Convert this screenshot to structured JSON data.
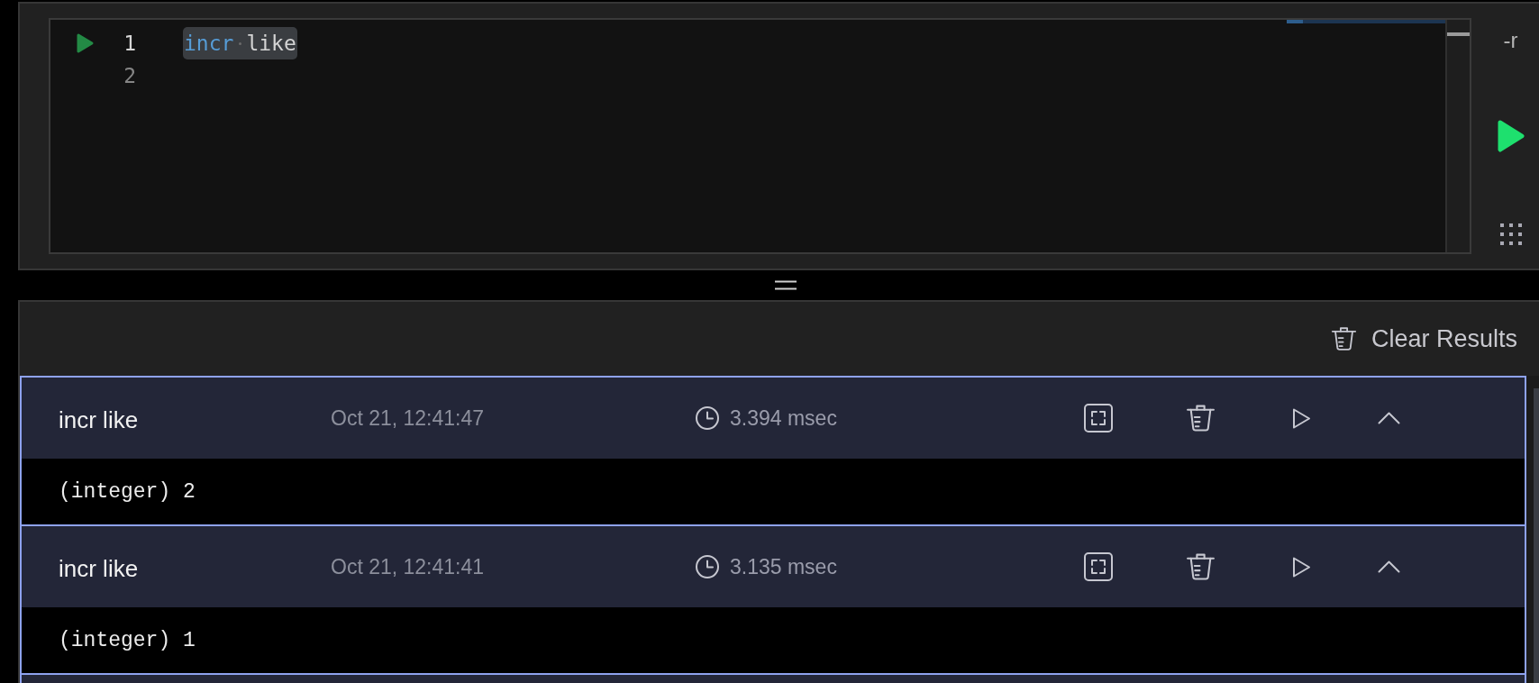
{
  "editor": {
    "lines": [
      {
        "number": "1",
        "active": true,
        "run_icon": true,
        "highlighted": true,
        "tokens": [
          {
            "text": "incr",
            "kind": "keyword"
          },
          {
            "text": "like",
            "kind": "plain"
          }
        ]
      },
      {
        "number": "2",
        "active": false,
        "run_icon": false,
        "highlighted": false
      }
    ]
  },
  "side_controls": {
    "raw_toggle": "-r"
  },
  "results_header": {
    "clear_button": "Clear Results"
  },
  "results": [
    {
      "command": "incr like",
      "timestamp": "Oct 21, 12:41:47",
      "duration": "3.394 msec",
      "output": "(integer) 2",
      "expanded": true
    },
    {
      "command": "incr like",
      "timestamp": "Oct 21, 12:41:41",
      "duration": "3.135 msec",
      "output": "(integer) 1",
      "expanded": true
    }
  ]
}
